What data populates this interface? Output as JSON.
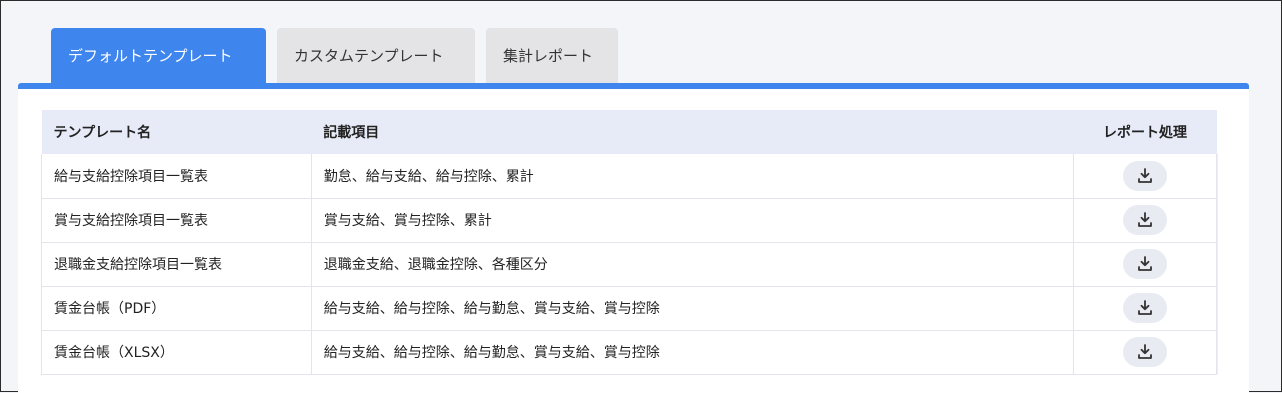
{
  "tabs": [
    {
      "label": "デフォルトテンプレート",
      "active": true
    },
    {
      "label": "カスタムテンプレート",
      "active": false
    },
    {
      "label": "集計レポート",
      "active": false
    }
  ],
  "table": {
    "headers": {
      "name": "テンプレート名",
      "items": "記載項目",
      "report": "レポート処理"
    },
    "rows": [
      {
        "name": "給与支給控除項目一覧表",
        "items": "勤怠、給与支給、給与控除、累計"
      },
      {
        "name": "賞与支給控除項目一覧表",
        "items": "賞与支給、賞与控除、累計"
      },
      {
        "name": "退職金支給控除項目一覧表",
        "items": "退職金支給、退職金控除、各種区分"
      },
      {
        "name": "賃金台帳（PDF）",
        "items": "給与支給、給与控除、給与勤怠、賞与支給、賞与控除"
      },
      {
        "name": "賃金台帳（XLSX）",
        "items": "給与支給、給与控除、給与勤怠、賞与支給、賞与控除"
      }
    ]
  },
  "icons": {
    "download": "download-icon"
  },
  "colors": {
    "accent": "#3f85ee",
    "header_bg": "#e7ebf7",
    "tab_inactive": "#e4e4e6"
  }
}
